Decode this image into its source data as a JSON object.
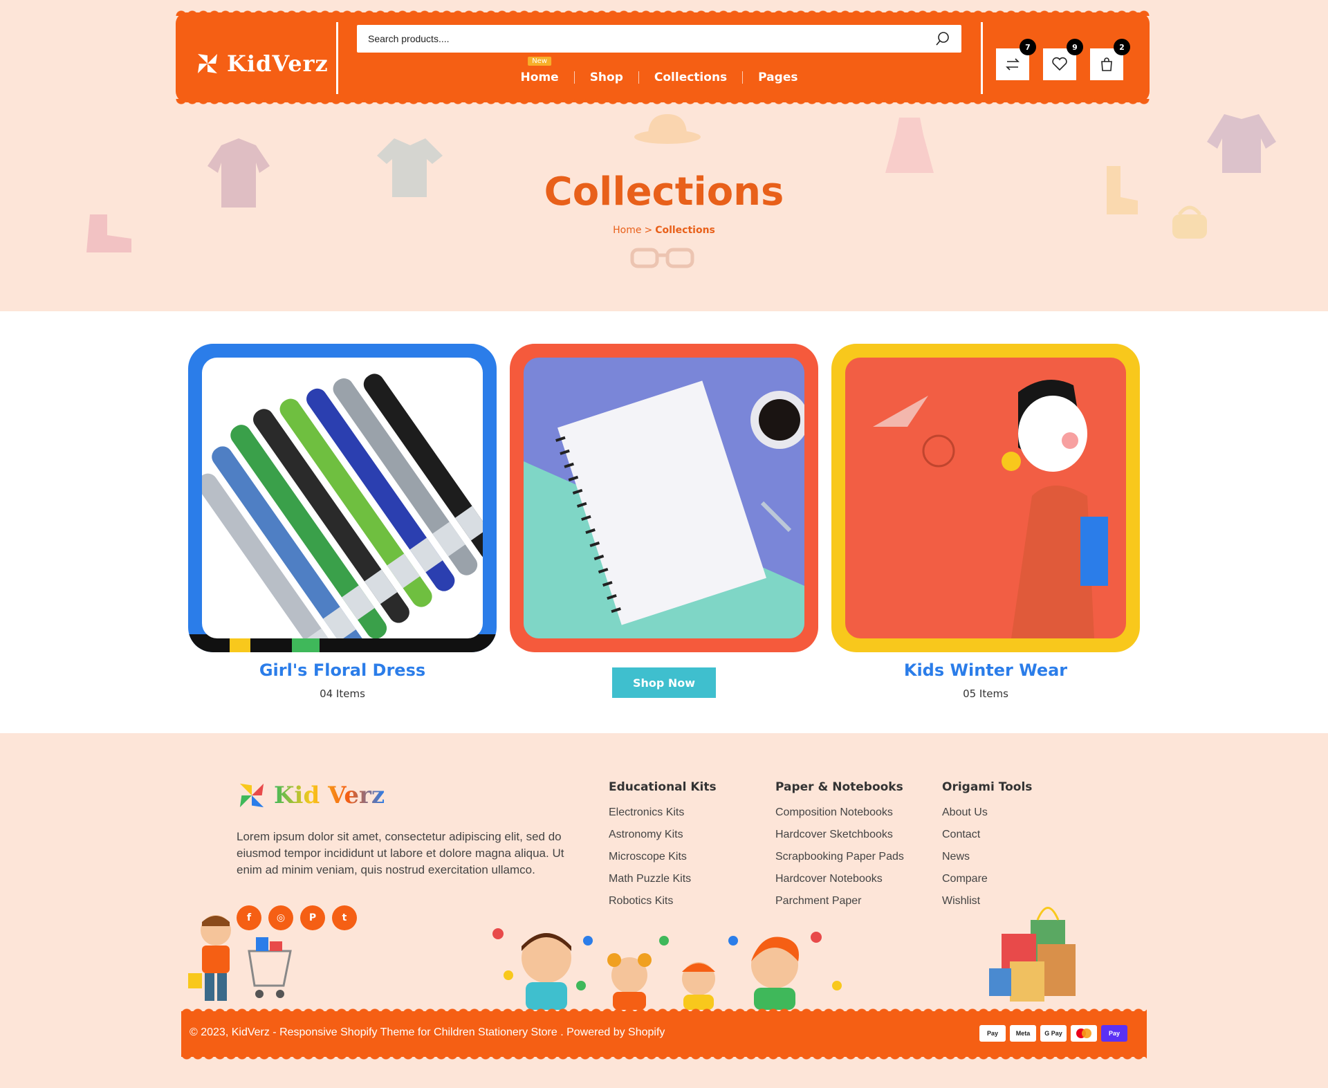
{
  "header": {
    "logo_text": "KidVerz",
    "search_placeholder": "Search products....",
    "nav": [
      {
        "label": "Home",
        "badge": "New"
      },
      {
        "label": "Shop"
      },
      {
        "label": "Collections"
      },
      {
        "label": "Pages"
      }
    ],
    "icons": [
      {
        "name": "compare-icon",
        "count": "7"
      },
      {
        "name": "heart-icon",
        "count": "9"
      },
      {
        "name": "bag-icon",
        "count": "2"
      }
    ]
  },
  "hero": {
    "title": "Collections",
    "breadcrumb": {
      "home": "Home",
      "separator": ">",
      "current": "Collections"
    }
  },
  "collections": [
    {
      "title": "Girl's Floral Dress",
      "count": "04 Items",
      "frame_color": "#2b7de9"
    },
    {
      "shop_label": "Shop Now",
      "frame_color": "#f55a3c"
    },
    {
      "title": "Kids Winter Wear",
      "count": "05 Items",
      "frame_color": "#f8c81c"
    }
  ],
  "footer": {
    "logo_text": "Kid Verz",
    "description": "Lorem ipsum dolor sit amet, consectetur adipiscing elit, sed do eiusmod tempor incididunt ut labore et dolore magna aliqua. Ut enim ad minim veniam, quis nostrud exercitation ullamco.",
    "socials": [
      "f",
      "◎",
      "P",
      "t"
    ],
    "columns": [
      {
        "title": "Educational Kits",
        "links": [
          "Electronics Kits",
          "Astronomy Kits",
          "Microscope Kits",
          "Math Puzzle Kits",
          "Robotics Kits"
        ]
      },
      {
        "title": "Paper & Notebooks",
        "links": [
          "Composition Notebooks",
          "Hardcover Sketchbooks",
          "Scrapbooking Paper Pads",
          "Hardcover Notebooks",
          "Parchment Paper"
        ]
      },
      {
        "title": "Origami Tools",
        "links": [
          "About Us",
          "Contact",
          "News",
          "Compare",
          "Wishlist"
        ]
      }
    ],
    "copyright": "© 2023, KidVerz - Responsive Shopify Theme for Children Stationery Store . Powered by Shopify",
    "payments": [
      "Pay",
      "Meta",
      "G Pay",
      "",
      "Pay"
    ]
  },
  "colors": {
    "brand_orange": "#f55f14",
    "title_orange": "#e8601a",
    "link_blue": "#2b7de9",
    "shop_btn": "#3fbfce"
  }
}
